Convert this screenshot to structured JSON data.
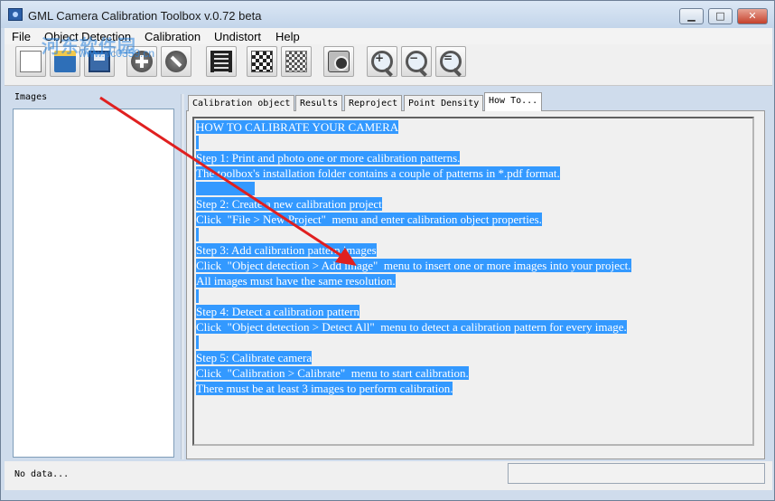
{
  "window": {
    "title": "GML Camera Calibration Toolbox  v.0.72 beta",
    "min_label": "▁",
    "max_label": "□",
    "close_label": "✕"
  },
  "menu": [
    "File",
    "Object Detection",
    "Calibration",
    "Undistort",
    "Help"
  ],
  "toolbar": [
    {
      "name": "new-project-button",
      "icon": "document-icon"
    },
    {
      "name": "open-project-button",
      "icon": "folder-icon"
    },
    {
      "name": "save-project-button",
      "icon": "disk-icon"
    },
    {
      "name": "add-image-button",
      "icon": "plus-icon"
    },
    {
      "name": "remove-image-button",
      "icon": "remove-icon"
    },
    {
      "name": "video-button",
      "icon": "film-icon"
    },
    {
      "name": "detect-pattern-button",
      "icon": "checkerboard-icon"
    },
    {
      "name": "detect-all-button",
      "icon": "checkerboard-detect-icon"
    },
    {
      "name": "camera-button",
      "icon": "camera-icon"
    },
    {
      "name": "zoom-in-button",
      "icon": "zoom-in-icon"
    },
    {
      "name": "zoom-out-button",
      "icon": "zoom-out-icon"
    },
    {
      "name": "zoom-fit-button",
      "icon": "zoom-fit-icon"
    }
  ],
  "images_panel": {
    "label": "Images"
  },
  "tabs": [
    {
      "label": "Calibration object",
      "active": false
    },
    {
      "label": "Results",
      "active": false
    },
    {
      "label": "Reproject",
      "active": false
    },
    {
      "label": "Point Density",
      "active": false
    },
    {
      "label": "How To...",
      "active": true
    }
  ],
  "howto_lines": [
    "HOW TO CALIBRATE YOUR CAMERA",
    " ",
    "Step 1: Print and photo one or more calibration patterns.",
    "The toolbox's installation folder contains a couple of patterns in *.pdf format.",
    "                    ",
    "Step 2: Create a new calibration project",
    "Click  \"File > New Project\"  menu and enter calibration object properties.",
    " ",
    "Step 3: Add calibration pattern images",
    "Click  \"Object detection > Add image\"  menu to insert one or more images into your project.",
    "All images must have the same resolution.",
    " ",
    "Step 4: Detect a calibration pattern",
    "Click  \"Object detection > Detect All\"  menu to detect a calibration pattern for every image.",
    " ",
    "Step 5: Calibrate camera",
    "Click  \"Calibration > Calibrate\"  menu to start calibration.",
    "There must be at least 3 images to perform calibration."
  ],
  "status": {
    "text": "No data..."
  },
  "watermark": {
    "text": "河东软件园",
    "url": "www.pc0359.cn"
  },
  "colors": {
    "selection": "#3399ff",
    "arrow": "#e02020"
  }
}
